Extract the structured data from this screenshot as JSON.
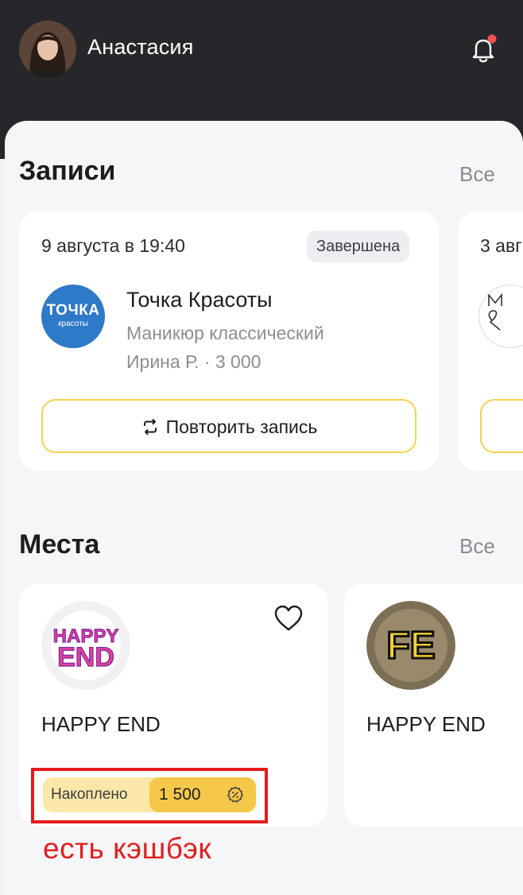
{
  "header": {
    "user_name": "Анастасия",
    "avatar_icon": "user-avatar",
    "bell_icon": "bell-icon",
    "has_unread": true
  },
  "bookings": {
    "title": "Записи",
    "all_label": "Все",
    "items": [
      {
        "date": "9 августа в 19:40",
        "status": "Завершена",
        "salon_logo_text": "ТОЧКА",
        "salon_logo_subtext": "красоты",
        "salon_name": "Точка Красоты",
        "service": "Маникюр классический",
        "master_price": "Ирина Р. · 3 000",
        "repeat_label": "Повторить запись"
      },
      {
        "date": "3 авг"
      }
    ]
  },
  "places": {
    "title": "Места",
    "all_label": "Все",
    "items": [
      {
        "logo_text_top": "HAPPY",
        "logo_text_bottom": "END",
        "name": "HAPPY END",
        "cashback_label": "Накоплено",
        "cashback_value": "1 500"
      },
      {
        "logo_text": "FE",
        "name": "HAPPY END"
      }
    ]
  },
  "annotation": {
    "note": "есть кэшбэк",
    "color": "#e51b1b"
  },
  "colors": {
    "header_bg": "#26272a",
    "accent_yellow": "#f5c84a",
    "notification_dot": "#f0514f"
  }
}
